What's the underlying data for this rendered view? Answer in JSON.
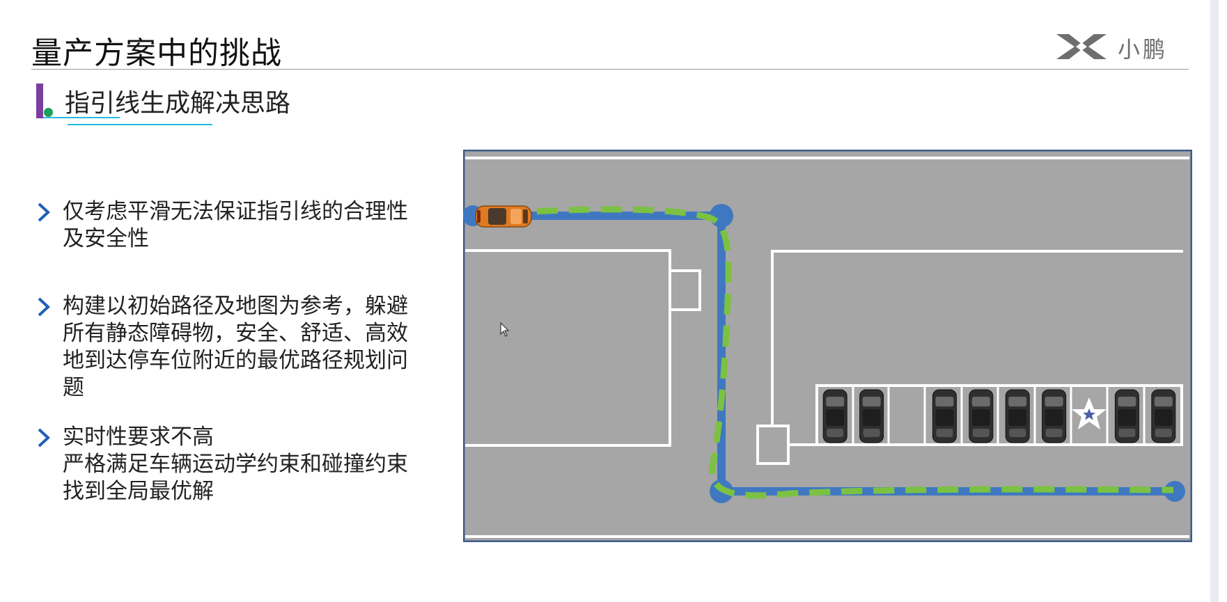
{
  "header": {
    "title": "量产方案中的挑战",
    "brand_name": "小鹏",
    "logo_icon": "xpeng-x-logo-icon"
  },
  "section": {
    "title": "指引线生成解决思路"
  },
  "bullets": [
    {
      "icon": "chevron-right-icon",
      "lines": [
        "仅考虑平滑无法保证指引线的合理性",
        "及安全性"
      ]
    },
    {
      "icon": "chevron-right-icon",
      "lines": [
        "构建以初始路径及地图为参考，躲避",
        "所有静态障碍物，安全、舒适、高效",
        "地到达停车位附近的最优路径规划问",
        "题"
      ]
    },
    {
      "icon": "chevron-right-icon",
      "lines": [
        "实时性要求不高",
        "严格满足车辆运动学约束和碰撞约束",
        "找到全局最优解"
      ]
    }
  ],
  "diagram": {
    "colors": {
      "road": "#a6a6a6",
      "border": "#3f5c8a",
      "lane_lines": "#ffffff",
      "reference_path": "#3f78c0",
      "optimized_path": "#7cc142",
      "ego_car": "#e07a22",
      "parked_car": "#2f2f2f"
    },
    "parking_slots": [
      "occupied",
      "occupied",
      "empty",
      "occupied",
      "occupied",
      "occupied",
      "occupied",
      "target",
      "occupied",
      "occupied"
    ],
    "target_icon": "star-icon"
  }
}
